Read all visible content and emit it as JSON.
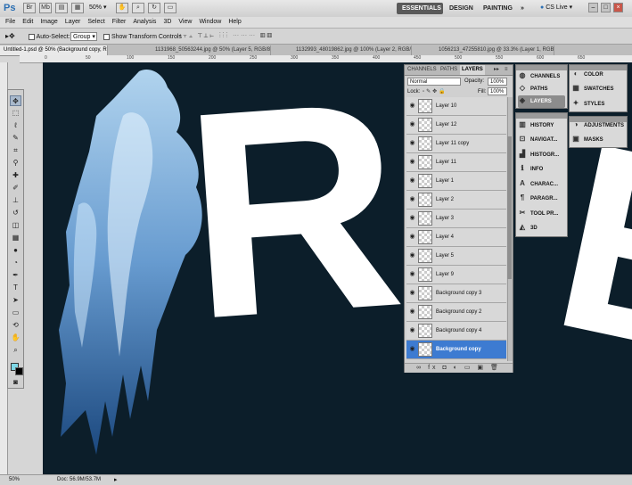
{
  "app": {
    "logo": "Ps",
    "zoom": "50%",
    "workspaces": [
      "ESSENTIALS",
      "DESIGN",
      "PAINTING",
      "»"
    ],
    "cs_live": "CS Live ▾",
    "window_controls": [
      "–",
      "□",
      "×"
    ]
  },
  "menu": [
    "File",
    "Edit",
    "Image",
    "Layer",
    "Select",
    "Filter",
    "Analysis",
    "3D",
    "View",
    "Window",
    "Help"
  ],
  "options": {
    "auto_select_label": "Auto-Select:",
    "auto_select_value": "Group",
    "show_transform_label": "Show Transform Controls"
  },
  "tabs": [
    "Untitled-1.psd @ 50% (Background copy, RGB/8) *",
    "1131968_50563244.jpg @ 50% (Layer 5, RGB/8) *",
    "1132993_48019862.jpg @ 100% (Layer 2, RGB/8) *",
    "1056213_47255810.jpg @ 33.3% (Layer 1, RGB/8) *"
  ],
  "ruler_top": [
    "0",
    "50",
    "100",
    "150",
    "200",
    "250",
    "300",
    "350",
    "400",
    "450",
    "500",
    "550",
    "600",
    "650"
  ],
  "canvas": {
    "letters": [
      "R",
      "E"
    ]
  },
  "layers_panel": {
    "tabs": [
      "CHANNELS",
      "PATHS",
      "LAYERS"
    ],
    "blend_mode": "Normal",
    "opacity_label": "Opacity:",
    "opacity_value": "100%",
    "lock_label": "Lock:",
    "fill_label": "Fill:",
    "fill_value": "100%",
    "layers": [
      "Layer 10",
      "Layer 12",
      "Layer 11 copy",
      "Layer 11",
      "Layer 1",
      "Layer 2",
      "Layer 3",
      "Layer 4",
      "Layer 5",
      "Layer 9",
      "Background copy 3",
      "Background copy 2",
      "Background copy 4",
      "Background copy"
    ],
    "selected_layer": "Background copy",
    "footer_icons": "∞ fx ◘ ◐ ▭ ▣ 🗑"
  },
  "dock_left": {
    "group1": [
      "CHANNELS",
      "PATHS",
      "LAYERS"
    ],
    "selected": "LAYERS",
    "group2": [
      "HISTORY",
      "NAVIGAT...",
      "HISTOGR...",
      "INFO",
      "CHARAC...",
      "PARAGR...",
      "TOOL PR...",
      "3D"
    ]
  },
  "dock_right": {
    "group1": [
      "COLOR",
      "SWATCHES",
      "STYLES"
    ],
    "group2": [
      "ADJUSTMENTS",
      "MASKS"
    ]
  },
  "status": {
    "zoom": "50%",
    "doc": "Doc: 56.9M/53.7M"
  },
  "colors": {
    "canvas_bg": "#0c1e2a",
    "foreground": "#7ed7e6",
    "background": "#000000",
    "selected_layer": "#3d7bd1"
  }
}
